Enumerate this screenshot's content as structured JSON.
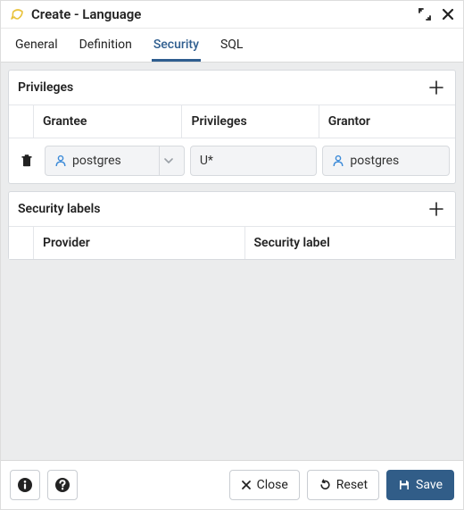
{
  "title": "Create - Language",
  "tabs": [
    {
      "label": "General"
    },
    {
      "label": "Definition"
    },
    {
      "label": "Security"
    },
    {
      "label": "SQL"
    }
  ],
  "active_tab": "Security",
  "privileges": {
    "title": "Privileges",
    "columns": {
      "grantee": "Grantee",
      "privileges": "Privileges",
      "grantor": "Grantor"
    },
    "rows": [
      {
        "grantee": "postgres",
        "privileges": "U*",
        "grantor": "postgres"
      }
    ]
  },
  "security_labels": {
    "title": "Security labels",
    "columns": {
      "provider": "Provider",
      "label": "Security label"
    }
  },
  "footer": {
    "close": "Close",
    "reset": "Reset",
    "save": "Save"
  }
}
